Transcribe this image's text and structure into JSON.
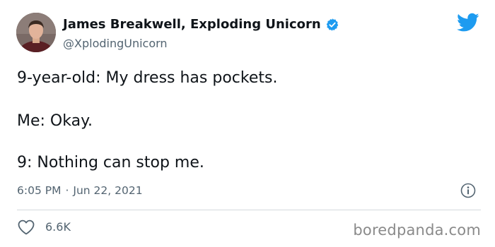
{
  "author": {
    "display_name": "James Breakwell, Exploding Unicorn",
    "handle": "@XplodingUnicorn",
    "verified": true,
    "avatar_icon": "avatar-photo"
  },
  "brand": {
    "icon": "twitter-bird-icon",
    "color": "#1d9bf0"
  },
  "tweet": {
    "lines": [
      "9-year-old: My dress has pockets.",
      "Me: Okay.",
      "9: Nothing can stop me."
    ],
    "time": "6:05 PM",
    "separator": "·",
    "date": "Jun 22, 2021"
  },
  "engagement": {
    "like_icon": "heart-icon",
    "like_count": "6.6K",
    "info_icon": "info-icon"
  },
  "watermark": "boredpanda.com",
  "colors": {
    "text": "#0f1419",
    "muted": "#536471",
    "divider": "#d4d9dd",
    "verified": "#1d9bf0"
  }
}
